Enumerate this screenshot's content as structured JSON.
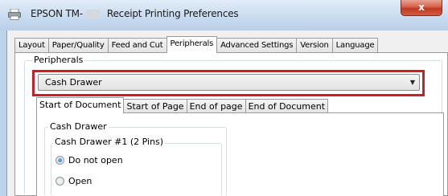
{
  "window": {
    "title_prefix": "EPSON TM-",
    "title_suffix": "Receipt Printing Preferences",
    "close_glyph": "x"
  },
  "tabs": [
    {
      "label": "Layout"
    },
    {
      "label": "Paper/Quality"
    },
    {
      "label": "Feed and Cut"
    },
    {
      "label": "Peripherals",
      "active": true
    },
    {
      "label": "Advanced Settings"
    },
    {
      "label": "Version"
    },
    {
      "label": "Language"
    }
  ],
  "peripherals": {
    "group_label": "Peripherals",
    "selected": "Cash Drawer",
    "highlight_color": "#c8202a"
  },
  "subtabs": [
    {
      "label": "Start of Document",
      "active": true
    },
    {
      "label": "Start of Page"
    },
    {
      "label": "End of page"
    },
    {
      "label": "End of Document"
    }
  ],
  "cash_drawer": {
    "group_label": "Cash Drawer",
    "drawer1_label": "Cash Drawer #1 (2 Pins)",
    "options": [
      {
        "label": "Do not open",
        "checked": true
      },
      {
        "label": "Open",
        "checked": false
      }
    ]
  }
}
